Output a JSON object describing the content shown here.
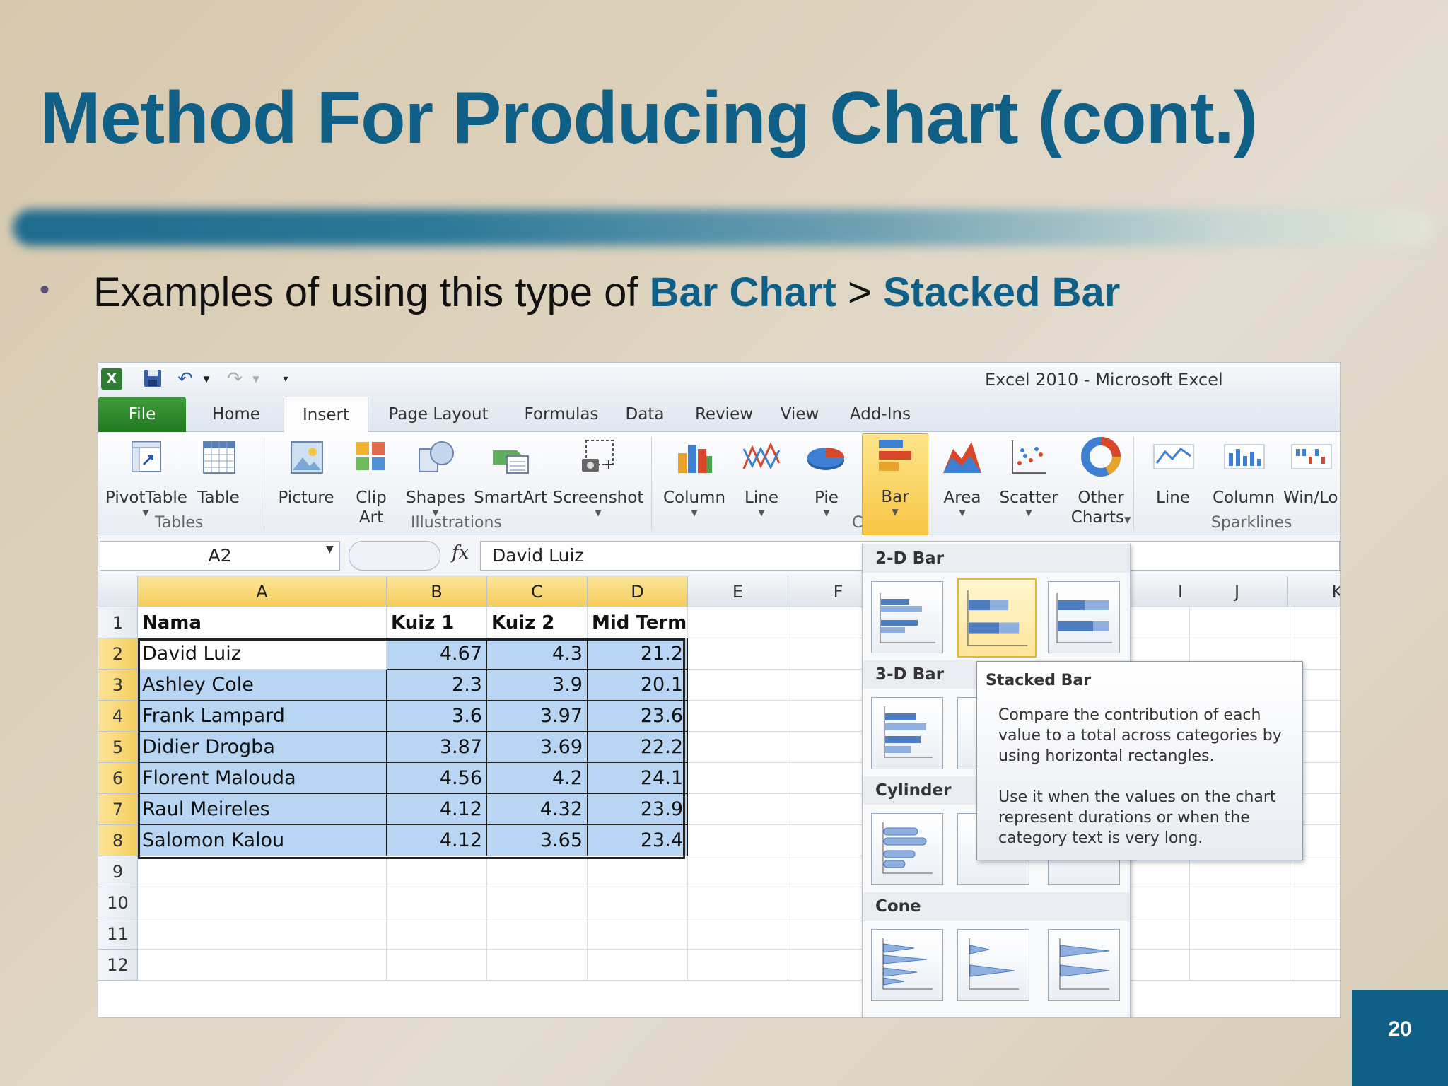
{
  "slide": {
    "title": "Method For Producing Chart (cont.)",
    "bullet_prefix": "Examples of using this type of ",
    "bullet_hl1": "Bar Chart",
    "bullet_sep": " > ",
    "bullet_hl2": "Stacked Bar",
    "page_number": "20"
  },
  "excel": {
    "app_title": "Excel 2010  -  Microsoft Excel",
    "tabs": [
      "File",
      "Home",
      "Insert",
      "Page Layout",
      "Formulas",
      "Data",
      "Review",
      "View",
      "Add-Ins"
    ],
    "ribbon": {
      "pivottable": "PivotTable",
      "table": "Table",
      "picture": "Picture",
      "clip1": "Clip",
      "clip2": "Art",
      "shapes": "Shapes",
      "smartart": "SmartArt",
      "screenshot": "Screenshot",
      "column": "Column",
      "line": "Line",
      "pie": "Pie",
      "bar": "Bar",
      "area": "Area",
      "scatter": "Scatter",
      "other1": "Other",
      "other2": "Charts",
      "sp_line": "Line",
      "sp_column": "Column",
      "sp_winloss": "Win/Lo",
      "group_tables": "Tables",
      "group_illustrations": "Illustrations",
      "group_charts": "C",
      "group_sparklines": "Sparklines"
    },
    "namebox": "A2",
    "formula": "David Luiz",
    "columns": [
      "A",
      "B",
      "C",
      "D",
      "E",
      "F",
      "I",
      "J",
      "K"
    ],
    "rows": [
      "1",
      "2",
      "3",
      "4",
      "5",
      "6",
      "7",
      "8",
      "9",
      "10",
      "11",
      "12"
    ],
    "header": [
      "Nama",
      "Kuiz 1",
      "Kuiz 2",
      "Mid Term"
    ],
    "data": [
      [
        "David Luiz",
        "4.67",
        "4.3",
        "21.2"
      ],
      [
        "Ashley Cole",
        "2.3",
        "3.9",
        "20.1"
      ],
      [
        "Frank Lampard",
        "3.6",
        "3.97",
        "23.6"
      ],
      [
        "Didier Drogba",
        "3.87",
        "3.69",
        "22.2"
      ],
      [
        "Florent Malouda",
        "4.56",
        "4.2",
        "24.1"
      ],
      [
        "Raul Meireles",
        "4.12",
        "4.32",
        "23.9"
      ],
      [
        "Salomon Kalou",
        "4.12",
        "3.65",
        "23.4"
      ]
    ],
    "gallery": {
      "h_2d": "2-D Bar",
      "h_3d": "3-D Bar",
      "h_cyl": "Cylinder",
      "h_cone": "Cone"
    },
    "tooltip": {
      "title": "Stacked Bar",
      "body1": "Compare the contribution of each value to a total across categories by using horizontal rectangles.",
      "body2": "Use it when the values on the chart represent durations or when the category text is very long."
    },
    "colors": {
      "file_tab": "#2f8a2e",
      "selection": "#b8d6f4",
      "title": "#0f5f86"
    }
  }
}
